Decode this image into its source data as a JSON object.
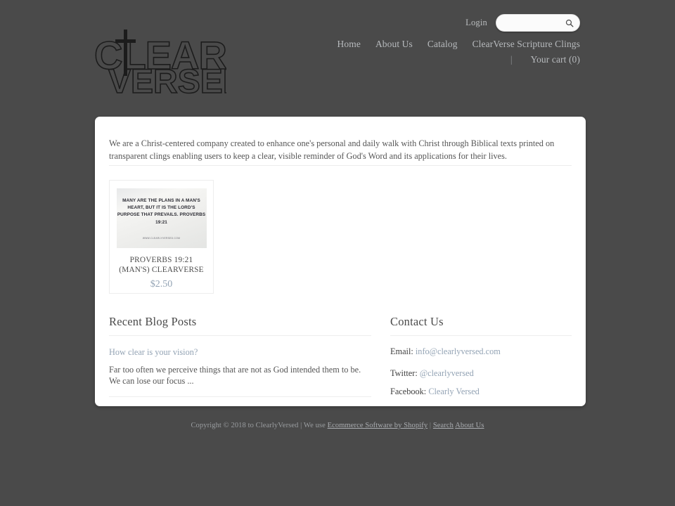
{
  "site": {
    "background_color": "#4a4a4a",
    "card_color": "#ffffff",
    "accent_color": "#93a3b4",
    "nav_text_color": "#b7babd"
  },
  "header": {
    "logo": {
      "line1": "CLEARLY",
      "line2": "VERSED",
      "icon": "cross-icon",
      "alt": "Clearly Versed"
    },
    "login_label": "Login",
    "search": {
      "value": "",
      "placeholder": "",
      "icon": "search-icon"
    },
    "nav_items": [
      {
        "label": "Home"
      },
      {
        "label": "About Us"
      },
      {
        "label": "Catalog"
      },
      {
        "label": "ClearVerse Scripture Clings"
      }
    ],
    "cart": {
      "separator": "|",
      "label": "Your cart (0)"
    }
  },
  "main": {
    "intro": "We are a Christ-centered company created to enhance one's personal and daily walk with Christ through Biblical texts printed on transparent clings enabling users to keep a clear, visible reminder of God's Word and its applications for their lives.",
    "products": [
      {
        "title_line1": "PROVERBS 19:21",
        "title_line2": "(MAN'S) CLEARVERSE",
        "price": "$2.50",
        "image_text": "Many are the plans in a man's heart, but it is the Lord's purpose that prevails. Proverbs 19:21",
        "image_url_text": "WWW.CLEARLYVERSED.COM"
      }
    ]
  },
  "blog": {
    "title": "Recent Blog Posts",
    "post_title": "How clear is your vision?",
    "post_excerpt": "Far too often we perceive things that are not as God intended them to be. We can lose our focus ..."
  },
  "contact": {
    "title": "Contact Us",
    "email_label": "Email:",
    "email_value": "info@clearlyversed.com",
    "twitter_label": "Twitter:",
    "twitter_value": "@clearlyversed",
    "facebook_label": "Facebook:",
    "facebook_value": "Clearly Versed"
  },
  "footer": {
    "copyright": "Copyright © 2018 to ClearlyVersed | We use",
    "software_link": "Ecommerce Software by Shopify",
    "sep": "|",
    "search_link": "Search",
    "about_link": "About Us"
  }
}
